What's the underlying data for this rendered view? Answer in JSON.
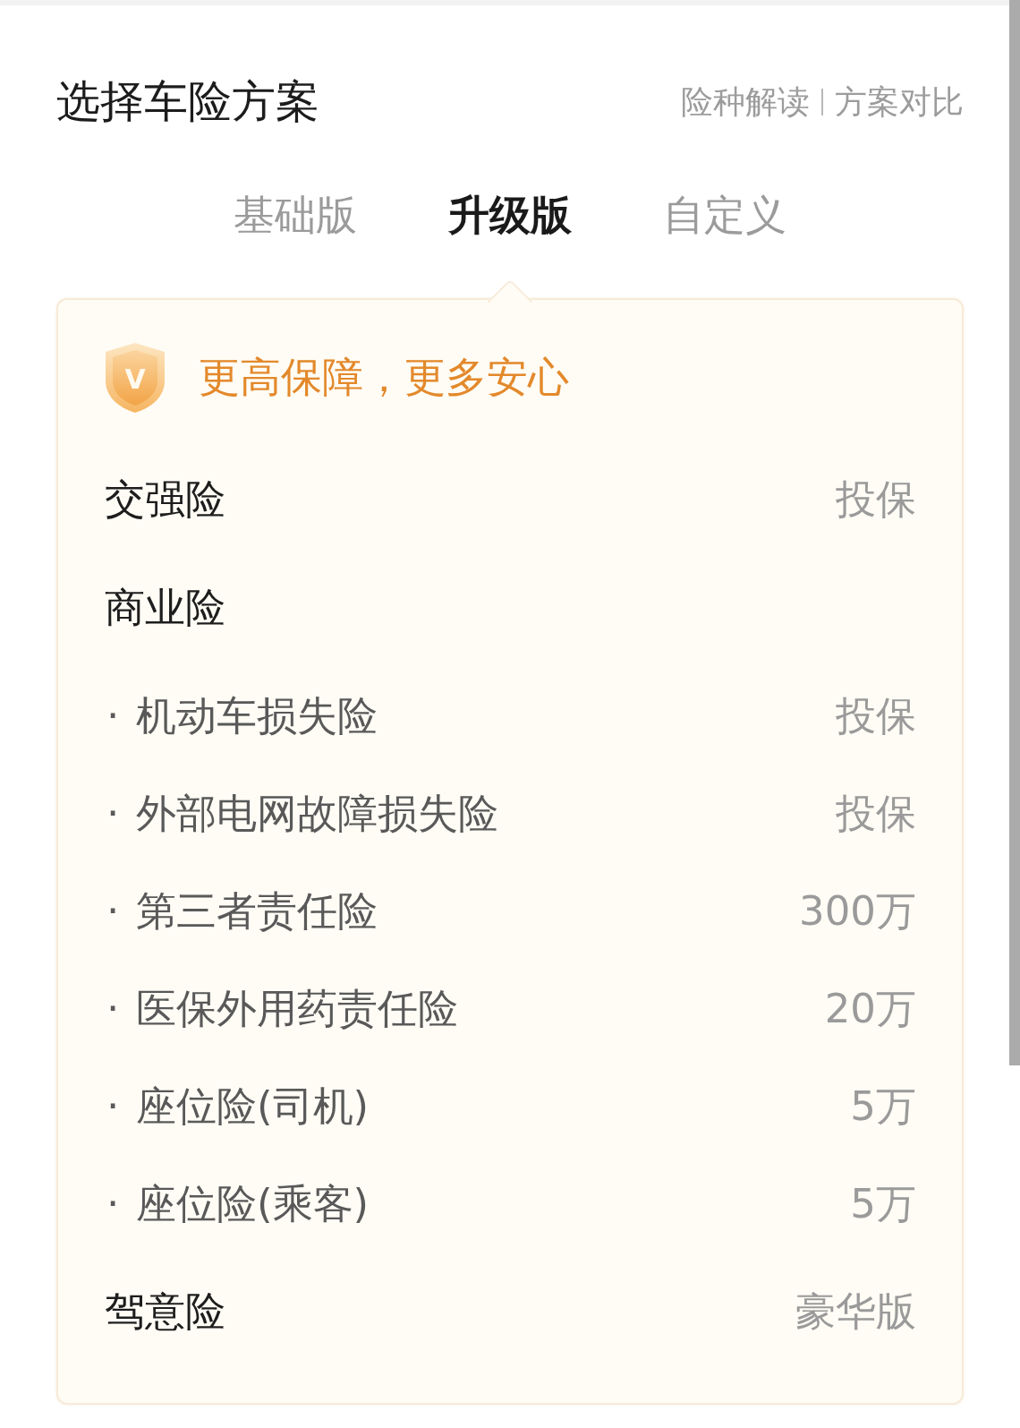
{
  "header": {
    "title": "选择车险方案",
    "links": [
      "险种解读",
      "方案对比"
    ]
  },
  "tabs": [
    {
      "label": "基础版",
      "selected": false
    },
    {
      "label": "升级版",
      "selected": true
    },
    {
      "label": "自定义",
      "selected": false
    }
  ],
  "plan": {
    "badge_letter": "V",
    "slogan": "更高保障，更多安心",
    "items": [
      {
        "label": "交强险",
        "value": "投保"
      },
      {
        "label": "商业险",
        "children": [
          {
            "bullet": "·",
            "label": "机动车损失险",
            "value": "投保"
          },
          {
            "bullet": "·",
            "label": "外部电网故障损失险",
            "value": "投保"
          },
          {
            "bullet": "·",
            "label": "第三者责任险",
            "value": "300万"
          },
          {
            "bullet": "·",
            "label": "医保外用药责任险",
            "value": "20万"
          },
          {
            "bullet": "·",
            "label": "座位险(司机)",
            "value": "5万"
          },
          {
            "bullet": "·",
            "label": "座位险(乘客)",
            "value": "5万"
          }
        ]
      },
      {
        "label": "驾意险",
        "value": "豪华版"
      }
    ]
  }
}
